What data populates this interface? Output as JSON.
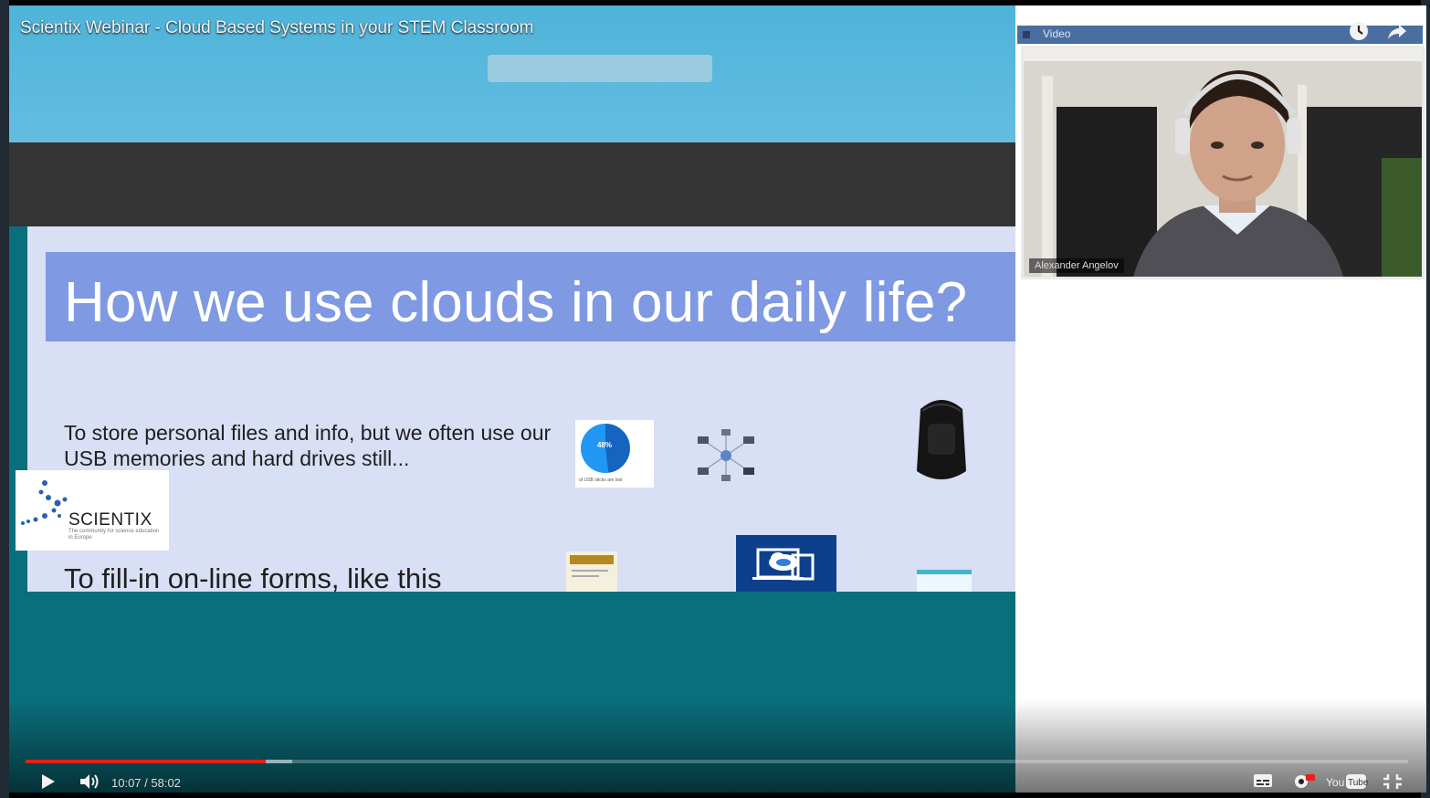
{
  "video": {
    "title": "Scientix Webinar - Cloud Based Systems in your STEM Classroom",
    "current_time": "10:07",
    "duration": "58:02",
    "time_display": "10:07 / 58:02",
    "progress_fraction": 0.174,
    "buffered_fraction": 0.193
  },
  "slide": {
    "title": "How we use clouds in our daily life?",
    "bullet_1": "To store personal files and info, but we often use our USB memories and hard drives still...",
    "bullet_2": "To fill-in on-line forms, like this",
    "pie_label": "48%",
    "pie_caption": "of USB sticks are lost"
  },
  "logo": {
    "name": "SCIENTIX",
    "tagline": "The community for science education in Europe"
  },
  "webcam": {
    "panel_label": "Video",
    "presenter_name": "Alexander Angelov"
  },
  "colors": {
    "progress": "#e62117",
    "slide_title_bar": "#7f99e2",
    "share_background": "#0a6f7c"
  },
  "icons": {
    "top": [
      "watch-later-icon",
      "share-icon"
    ],
    "bottom_left": [
      "play-icon",
      "volume-icon"
    ],
    "bottom_right": [
      "captions-icon",
      "settings-icon",
      "youtube-logo-icon",
      "fullscreen-exit-icon"
    ]
  }
}
